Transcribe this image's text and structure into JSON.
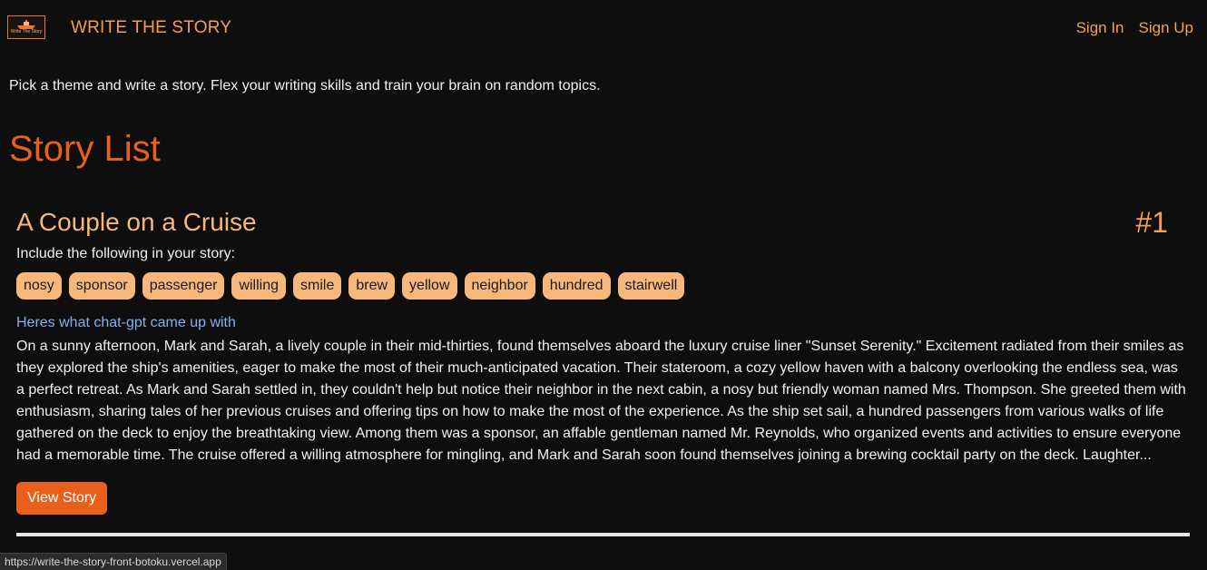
{
  "navbar": {
    "logo_text": "Write The Story",
    "brand": "WRITE THE STORY",
    "sign_in": "Sign In",
    "sign_up": "Sign Up"
  },
  "tagline": "Pick a theme and write a story. Flex your writing skills and train your brain on random topics.",
  "page_title": "Story List",
  "story": {
    "title": "A Couple on a Cruise",
    "number": "#1",
    "include_label": "Include the following in your story:",
    "tags": [
      "nosy",
      "sponsor",
      "passenger",
      "willing",
      "smile",
      "brew",
      "yellow",
      "neighbor",
      "hundred",
      "stairwell"
    ],
    "gpt_label": "Heres what chat-gpt came up with",
    "text": "On a sunny afternoon, Mark and Sarah, a lively couple in their mid-thirties, found themselves aboard the luxury cruise liner \"Sunset Serenity.\" Excitement radiated from their smiles as they explored the ship's amenities, eager to make the most of their much-anticipated vacation. Their stateroom, a cozy yellow haven with a balcony overlooking the endless sea, was a perfect retreat. As Mark and Sarah settled in, they couldn't help but notice their neighbor in the next cabin, a nosy but friendly woman named Mrs. Thompson. She greeted them with enthusiasm, sharing tales of her previous cruises and offering tips on how to make the most of the experience. As the ship set sail, a hundred passengers from various walks of life gathered on the deck to enjoy the breathtaking view. Among them was a sponsor, an affable gentleman named Mr. Reynolds, who organized events and activities to ensure everyone had a memorable time. The cruise offered a willing atmosphere for mingling, and Mark and Sarah soon found themselves joining a brewing cocktail party on the deck. Laughter...",
    "view_button": "View Story"
  },
  "status_url": "https://write-the-story-front-botoku.vercel.app",
  "colors": {
    "background": "#0e0e0f",
    "accent": "#e8601c",
    "brand_orange": "#f5a04f",
    "tag_bg": "#f7b77a",
    "link_blue": "#7fb3f0"
  }
}
